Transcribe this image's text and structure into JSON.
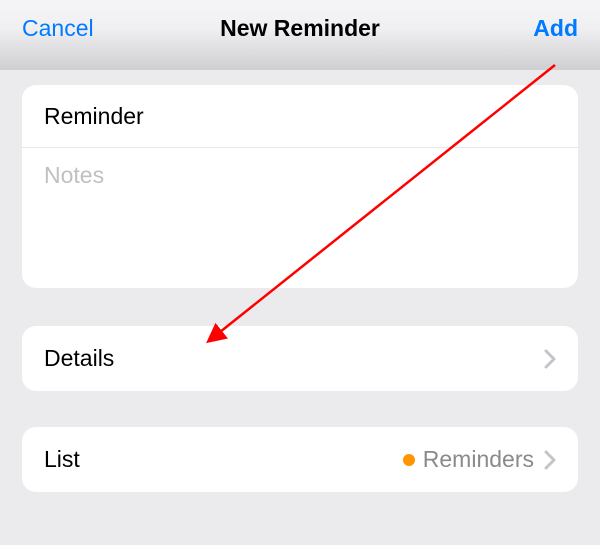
{
  "navbar": {
    "cancel_label": "Cancel",
    "title": "New Reminder",
    "add_label": "Add"
  },
  "reminder_input": {
    "title_placeholder": "Reminder",
    "notes_placeholder": "Notes"
  },
  "details_row": {
    "label": "Details"
  },
  "list_row": {
    "label": "List",
    "selected_value": "Reminders",
    "dot_color": "#ff9500"
  }
}
